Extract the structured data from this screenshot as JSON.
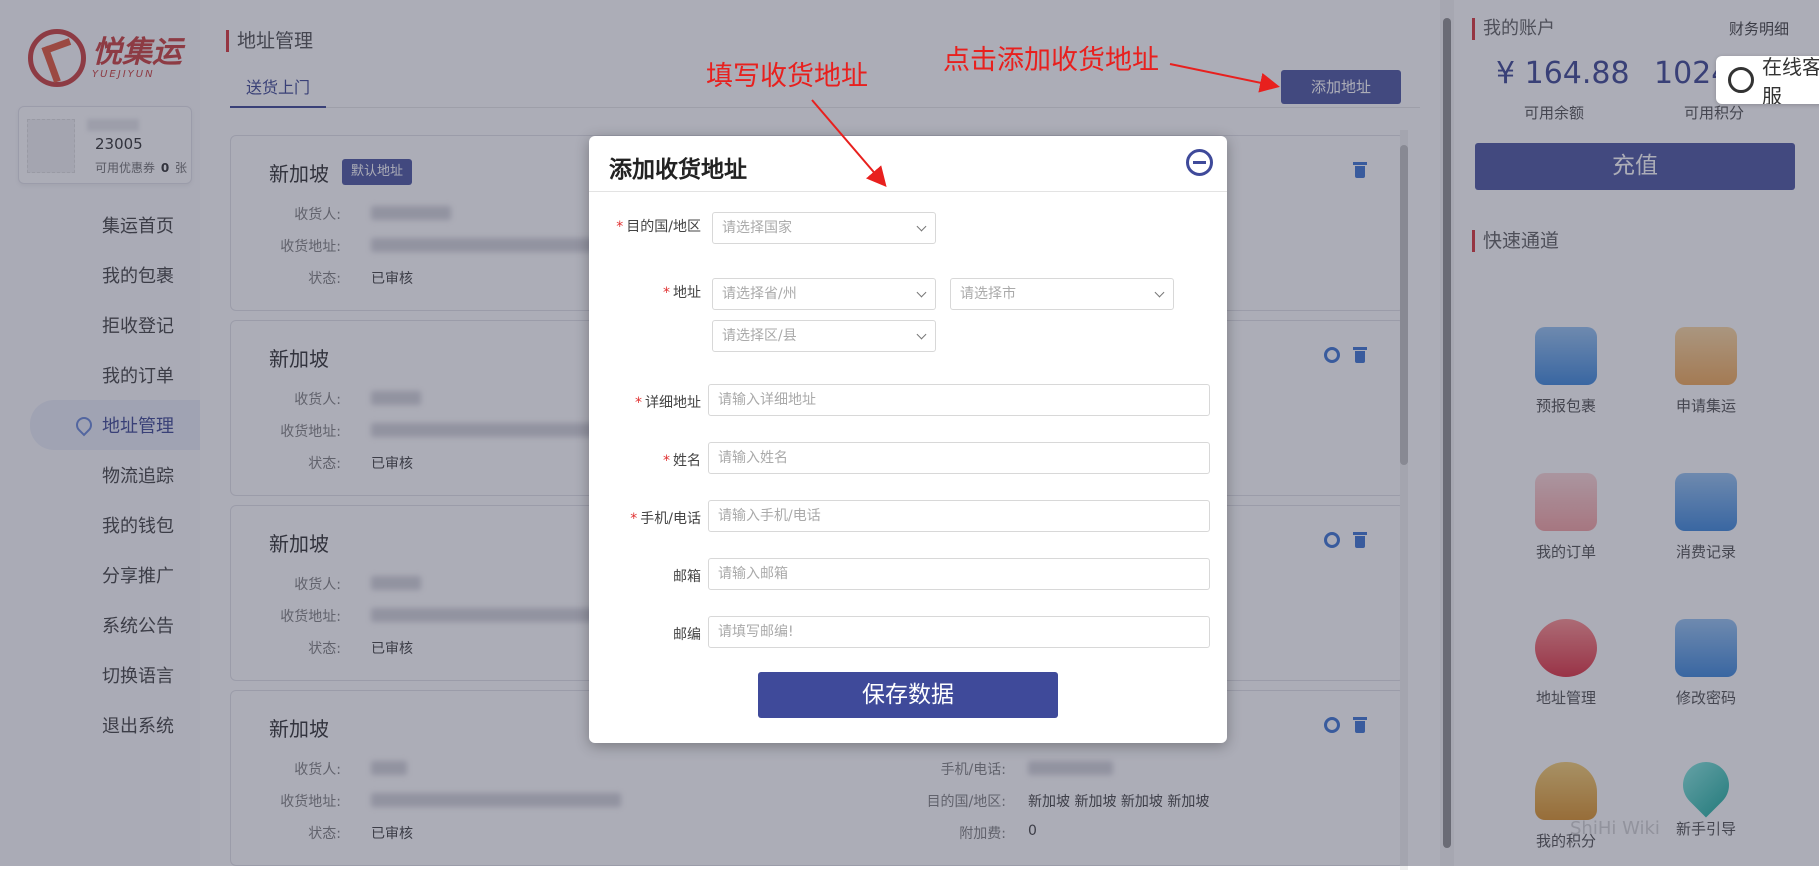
{
  "brand": {
    "name": "悦集运",
    "name_en": "YUEJIYUN"
  },
  "user": {
    "id_suffix": "23005",
    "coupon_text": "可用优惠券",
    "coupon_count": "0",
    "coupon_unit": "张"
  },
  "nav": {
    "items": [
      {
        "label": "集运首页"
      },
      {
        "label": "我的包裹"
      },
      {
        "label": "拒收登记"
      },
      {
        "label": "我的订单"
      },
      {
        "label": "地址管理",
        "active": true
      },
      {
        "label": "物流追踪"
      },
      {
        "label": "我的钱包"
      },
      {
        "label": "分享推广"
      },
      {
        "label": "系统公告"
      },
      {
        "label": "切换语言"
      },
      {
        "label": "退出系统"
      }
    ]
  },
  "main": {
    "section_title": "地址管理",
    "tab_label": "送货上门",
    "add_button": "添加地址",
    "default_badge": "默认地址",
    "labels": {
      "receiver": "收货人:",
      "address": "收货地址:",
      "status": "状态:",
      "phone": "手机/电话:",
      "country": "目的国/地区:",
      "surcharge": "附加费:"
    },
    "cards": [
      {
        "country": "新加坡",
        "status": "已审核"
      },
      {
        "country": "新加坡",
        "status": "已审核"
      },
      {
        "country": "新加坡",
        "status": "已审核"
      },
      {
        "country": "新加坡",
        "status": "已审核",
        "country_value": "新加坡 新加坡 新加坡 新加坡",
        "surcharge_value": "0"
      }
    ]
  },
  "account": {
    "title": "我的账户",
    "detail_link": "财务明细",
    "balance": "¥ 164.88",
    "balance_label": "可用余额",
    "points": "1024",
    "points_label": "可用积分",
    "recharge": "充值",
    "chat": "在线客服"
  },
  "quick": {
    "title": "快速通道",
    "items": [
      {
        "label": "预报包裹",
        "icon": "box-icon"
      },
      {
        "label": "申请集运",
        "icon": "truck-icon"
      },
      {
        "label": "我的订单",
        "icon": "clipboard-icon"
      },
      {
        "label": "消费记录",
        "icon": "card-icon"
      },
      {
        "label": "地址管理",
        "icon": "user-gear-icon"
      },
      {
        "label": "修改密码",
        "icon": "gear-box-icon"
      },
      {
        "label": "我的积分",
        "icon": "coins-icon"
      },
      {
        "label": "新手引导",
        "icon": "map-pin-icon"
      }
    ]
  },
  "modal": {
    "title": "添加收货地址",
    "fields": {
      "country_label": "目的国/地区",
      "country_placeholder": "请选择国家",
      "address_label": "地址",
      "province_placeholder": "请选择省/州",
      "city_placeholder": "请选择市",
      "district_placeholder": "请选择区/县",
      "detail_label": "详细地址",
      "detail_placeholder": "请输入详细地址",
      "name_label": "姓名",
      "name_placeholder": "请输入姓名",
      "phone_label": "手机/电话",
      "phone_placeholder": "请输入手机/电话",
      "email_label": "邮箱",
      "email_placeholder": "请输入邮箱",
      "zip_label": "邮编",
      "zip_placeholder": "请填写邮编!"
    },
    "save_button": "保存数据"
  },
  "annotations": {
    "fill_address": "填写收货地址",
    "click_add": "点击添加收货地址",
    "color": "#e8201e"
  },
  "watermark": "ShiHi Wiki"
}
